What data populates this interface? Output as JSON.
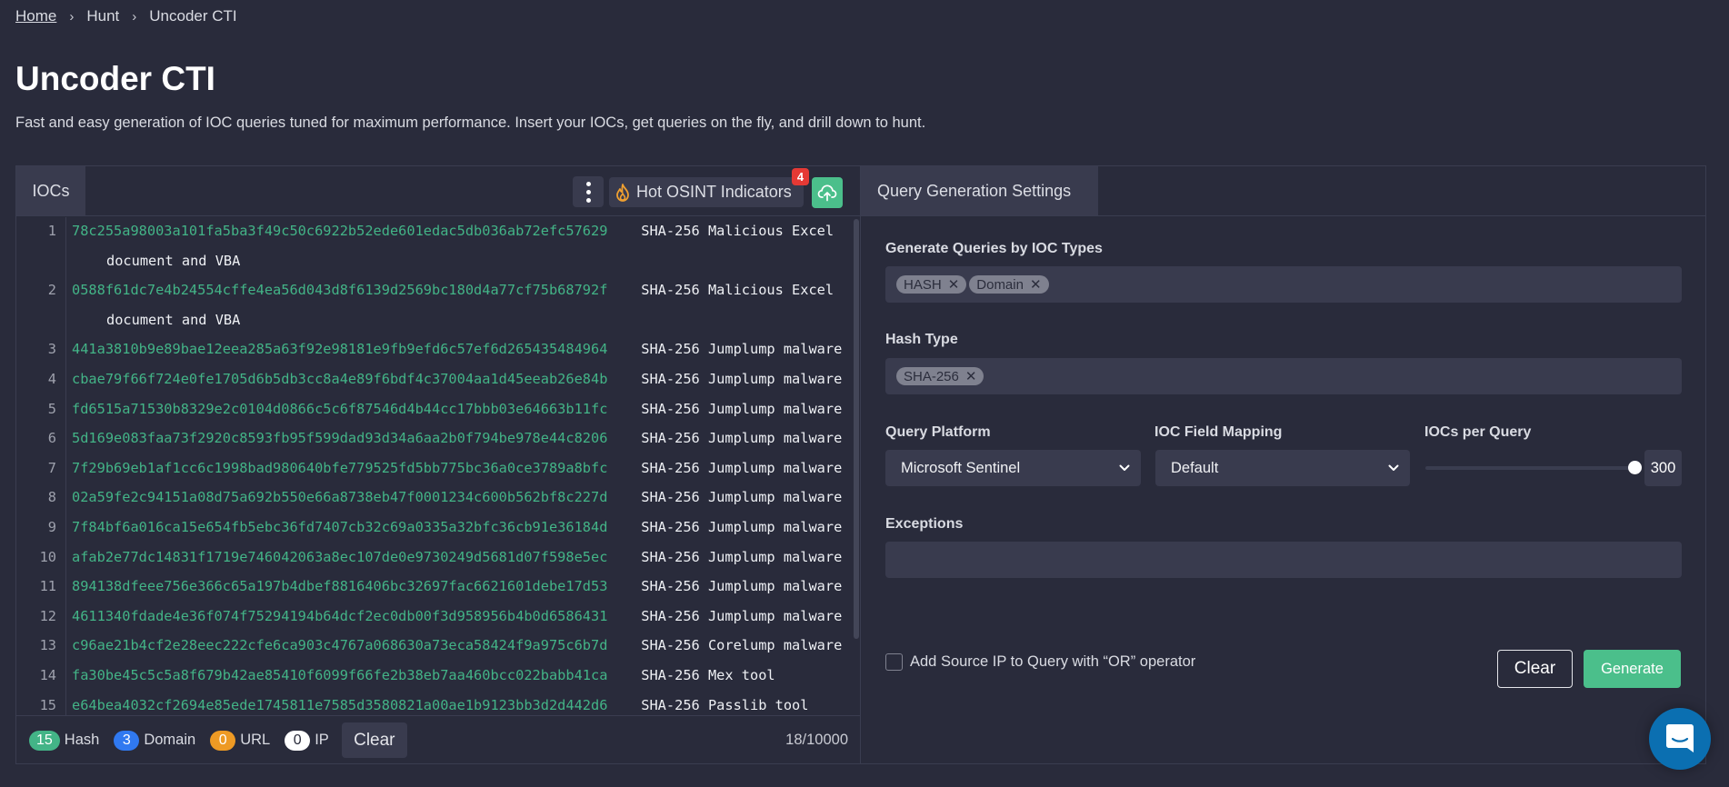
{
  "breadcrumb": {
    "items": [
      "Home",
      "Hunt",
      "Uncoder CTI"
    ]
  },
  "header": {
    "title": "Uncoder CTI",
    "description": "Fast and easy generation of IOC queries tuned for maximum performance. Insert your IOCs, get queries on the fly, and drill down to hunt."
  },
  "ioc_panel": {
    "tab_label": "IOCs",
    "hot_osint_label": "Hot OSINT Indicators",
    "hot_osint_badge": "4",
    "lines": [
      {
        "n": "1",
        "hash": "78c255a98003a101fa5ba3f49c50c6922b52ede601edac5db036ab72efc57629",
        "desc": "SHA-256 Malicious Excel",
        "wrap": "document and VBA"
      },
      {
        "n": "2",
        "hash": "0588f61dc7e4b24554cffe4ea56d043d8f6139d2569bc180d4a77cf75b68792f",
        "desc": "SHA-256 Malicious Excel",
        "wrap": "document and VBA"
      },
      {
        "n": "3",
        "hash": "441a3810b9e89bae12eea285a63f92e98181e9fb9efd6c57ef6d265435484964",
        "desc": "SHA-256 Jumplump malware"
      },
      {
        "n": "4",
        "hash": "cbae79f66f724e0fe1705d6b5db3cc8a4e89f6bdf4c37004aa1d45eeab26e84b",
        "desc": "SHA-256 Jumplump malware"
      },
      {
        "n": "5",
        "hash": "fd6515a71530b8329e2c0104d0866c5c6f87546d4b44cc17bbb03e64663b11fc",
        "desc": "SHA-256 Jumplump malware"
      },
      {
        "n": "6",
        "hash": "5d169e083faa73f2920c8593fb95f599dad93d34a6aa2b0f794be978e44c8206",
        "desc": "SHA-256 Jumplump malware"
      },
      {
        "n": "7",
        "hash": "7f29b69eb1af1cc6c1998bad980640bfe779525fd5bb775bc36a0ce3789a8bfc",
        "desc": "SHA-256 Jumplump malware"
      },
      {
        "n": "8",
        "hash": "02a59fe2c94151a08d75a692b550e66a8738eb47f0001234c600b562bf8c227d",
        "desc": "SHA-256 Jumplump malware"
      },
      {
        "n": "9",
        "hash": "7f84bf6a016ca15e654fb5ebc36fd7407cb32c69a0335a32bfc36cb91e36184d",
        "desc": "SHA-256 Jumplump malware"
      },
      {
        "n": "10",
        "hash": "afab2e77dc14831f1719e746042063a8ec107de0e9730249d5681d07f598e5ec",
        "desc": "SHA-256 Jumplump malware"
      },
      {
        "n": "11",
        "hash": "894138dfeee756e366c65a197b4dbef8816406bc32697fac6621601debe17d53",
        "desc": "SHA-256 Jumplump malware"
      },
      {
        "n": "12",
        "hash": "4611340fdade4e36f074f75294194b64dcf2ec0db00f3d958956b4b0d6586431",
        "desc": "SHA-256 Jumplump malware"
      },
      {
        "n": "13",
        "hash": "c96ae21b4cf2e28eec222cfe6ca903c4767a068630a73eca58424f9a975c6b7d",
        "desc": "SHA-256 Corelump malware"
      },
      {
        "n": "14",
        "hash": "fa30be45c5c5a8f679b42ae85410f6099f66fe2b38eb7aa460bcc022babb41ca",
        "desc": "SHA-256 Mex tool"
      },
      {
        "n": "15",
        "hash": "e64bea4032cf2694e85ede1745811e7585d3580821a00ae1b9123bb3d2d442d6",
        "desc": "SHA-256 Passlib tool"
      }
    ],
    "counts": {
      "hash": {
        "value": "15",
        "label": "Hash"
      },
      "domain": {
        "value": "3",
        "label": "Domain"
      },
      "url": {
        "value": "0",
        "label": "URL"
      },
      "ip": {
        "value": "0",
        "label": "IP"
      }
    },
    "clear_label": "Clear",
    "char_count": "18/10000"
  },
  "settings_panel": {
    "tab_label": "Query Generation Settings",
    "ioc_types_label": "Generate Queries by IOC Types",
    "ioc_types": [
      "HASH",
      "Domain"
    ],
    "hash_type_label": "Hash Type",
    "hash_types": [
      "SHA-256"
    ],
    "query_platform_label": "Query Platform",
    "query_platform_value": "Microsoft Sentinel",
    "field_mapping_label": "IOC Field Mapping",
    "field_mapping_value": "Default",
    "iocs_per_query_label": "IOCs per Query",
    "iocs_per_query_value": "300",
    "iocs_per_query_fraction": 1.0,
    "exceptions_label": "Exceptions",
    "exceptions_value": "",
    "source_ip_checkbox_label": "Add Source IP to Query with “OR” operator",
    "source_ip_checked": false,
    "clear_label": "Clear",
    "generate_label": "Generate"
  },
  "colors": {
    "background": "#292b3b",
    "panel_tab": "#393b4e",
    "accent_green": "#4bbf8b",
    "hash_text": "#43b487",
    "domain_blue": "#3079f0",
    "url_orange": "#ee9a24",
    "badge_red": "#e53935",
    "chat_blue": "#0b6fb1"
  }
}
